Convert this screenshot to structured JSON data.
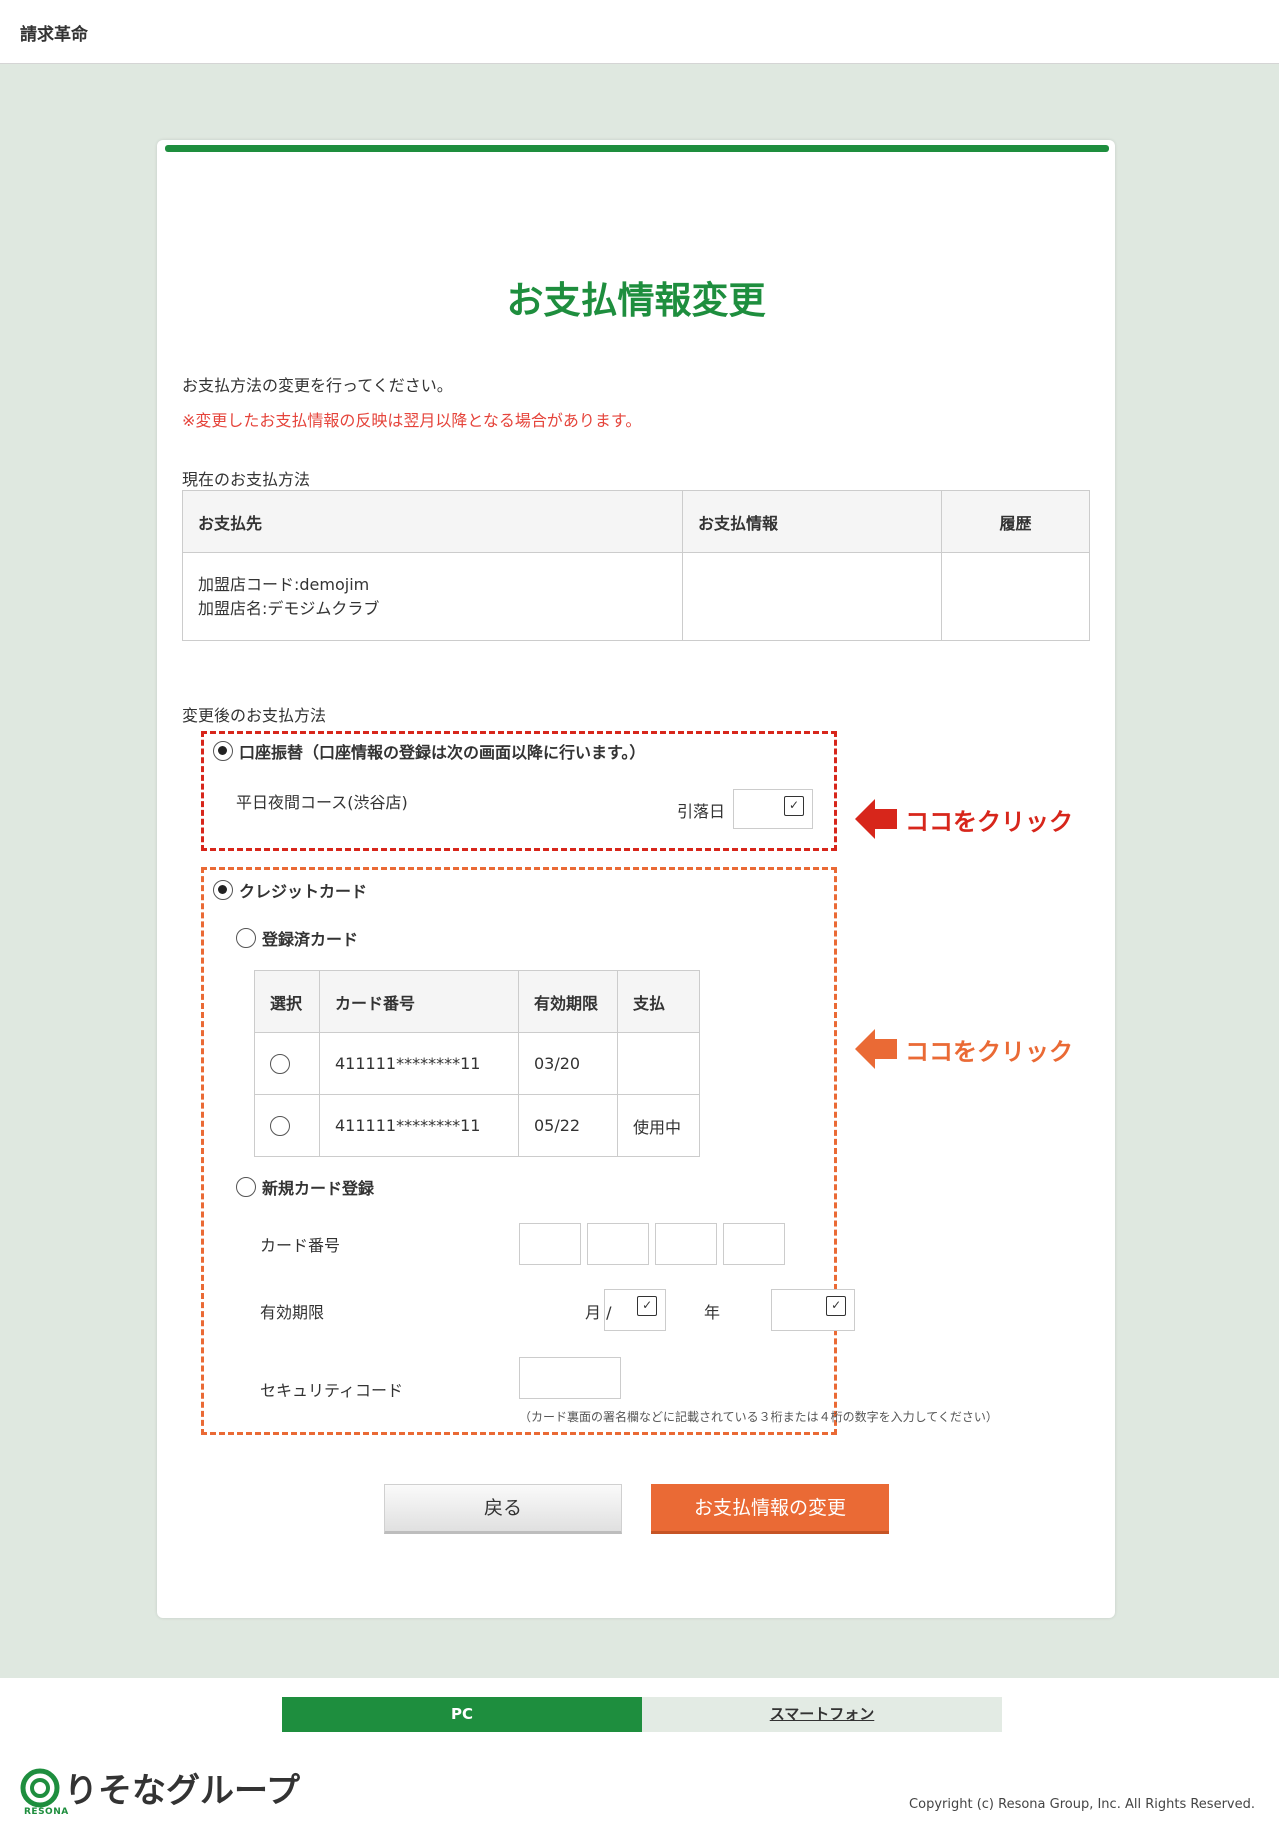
{
  "header": {
    "brand": "請求革命"
  },
  "page": {
    "title": "お支払情報変更",
    "intro": "お支払方法の変更を行ってください。",
    "note": "※変更したお支払情報の反映は翌月以降となる場合があります。"
  },
  "current": {
    "label": "現在のお支払方法",
    "headers": [
      "お支払先",
      "お支払情報",
      "履歴"
    ],
    "store_code": "加盟店コード:demojim",
    "store_name": "加盟店名:デモジムクラブ",
    "payment_info": "",
    "history": ""
  },
  "change": {
    "label": "変更後のお支払方法",
    "bank": {
      "label": "口座振替（口座情報の登録は次の画面以降に行います。）",
      "course": "平日夜間コース(渋谷店)",
      "debit_day_label": "引落日",
      "debit_day_value": "",
      "selected": true
    },
    "credit": {
      "label": "クレジットカード",
      "selected": true,
      "registered": {
        "label": "登録済カード",
        "selected": false,
        "headers": [
          "選択",
          "カード番号",
          "有効期限",
          "支払"
        ],
        "rows": [
          {
            "number": "411111********11",
            "expiry": "03/20",
            "status": ""
          },
          {
            "number": "411111********11",
            "expiry": "05/22",
            "status": "使用中"
          }
        ]
      },
      "new_card": {
        "label": "新規カード登録",
        "selected": false,
        "card_number_label": "カード番号",
        "expiry_label": "有効期限",
        "month_unit": "月 /",
        "year_unit": "年",
        "security_label": "セキュリティコード",
        "security_hint": "（カード裏面の署名欄などに記載されている３桁または４桁の数字を入力してください）"
      }
    }
  },
  "callouts": [
    "ココをクリック",
    "ココをクリック"
  ],
  "buttons": {
    "back": "戻る",
    "submit": "お支払情報の変更"
  },
  "footer": {
    "tab_pc": "PC",
    "tab_smartphone": "スマートフォン",
    "logo_text": "りそなグループ",
    "logo_sub": "RESONA",
    "copyright": "Copyright (c) Resona Group, Inc. All Rights Reserved."
  },
  "colors": {
    "green": "#1e8e3e",
    "orange": "#ea6a35",
    "red": "#d7261b"
  }
}
